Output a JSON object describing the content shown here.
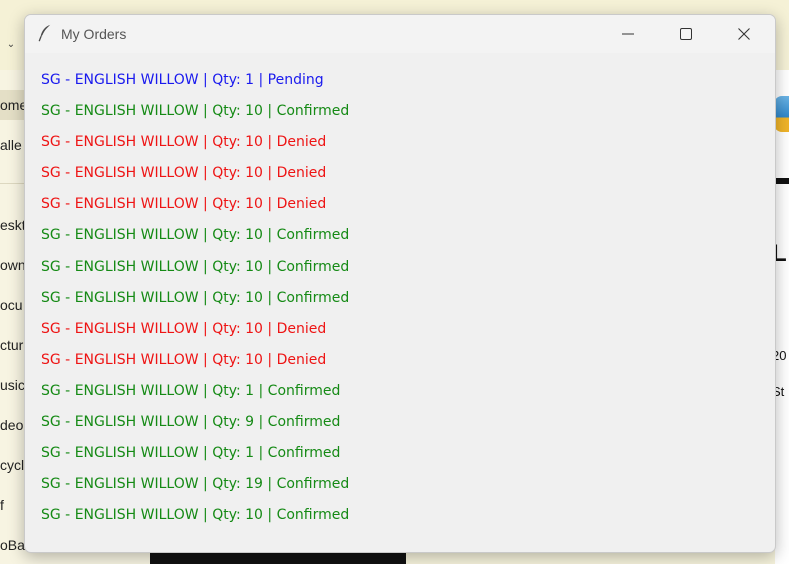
{
  "window": {
    "title": "My Orders",
    "app_icon": "feather-icon",
    "controls": [
      "minimize-icon",
      "maximize-icon",
      "close-icon"
    ]
  },
  "status_colors": {
    "Pending": "#1a1aee",
    "Confirmed": "#158a15",
    "Denied": "#ee1414"
  },
  "orders": [
    {
      "text": "SG - ENGLISH WILLOW | Qty: 1 | Pending",
      "status": "Pending"
    },
    {
      "text": "SG - ENGLISH WILLOW | Qty: 10 | Confirmed",
      "status": "Confirmed"
    },
    {
      "text": "SG - ENGLISH WILLOW | Qty: 10 | Denied",
      "status": "Denied"
    },
    {
      "text": "SG - ENGLISH WILLOW | Qty: 10 | Denied",
      "status": "Denied"
    },
    {
      "text": "SG - ENGLISH WILLOW | Qty: 10 | Denied",
      "status": "Denied"
    },
    {
      "text": "SG - ENGLISH WILLOW | Qty: 10 | Confirmed",
      "status": "Confirmed"
    },
    {
      "text": "SG - ENGLISH WILLOW | Qty: 10 | Confirmed",
      "status": "Confirmed"
    },
    {
      "text": "SG - ENGLISH WILLOW | Qty: 10 | Confirmed",
      "status": "Confirmed"
    },
    {
      "text": "SG - ENGLISH WILLOW | Qty: 10 | Denied",
      "status": "Denied"
    },
    {
      "text": "SG - ENGLISH WILLOW | Qty: 10 | Denied",
      "status": "Denied"
    },
    {
      "text": "SG - ENGLISH WILLOW | Qty: 1 | Confirmed",
      "status": "Confirmed"
    },
    {
      "text": "SG - ENGLISH WILLOW | Qty: 9 | Confirmed",
      "status": "Confirmed"
    },
    {
      "text": "SG - ENGLISH WILLOW | Qty: 1 | Confirmed",
      "status": "Confirmed"
    },
    {
      "text": "SG - ENGLISH WILLOW | Qty: 19 | Confirmed",
      "status": "Confirmed"
    },
    {
      "text": "SG - ENGLISH WILLOW | Qty: 10 | Confirmed",
      "status": "Confirmed"
    }
  ],
  "background": {
    "sidebar_items": [
      "ome",
      "alle",
      "eskto",
      "own",
      "ocu",
      "cture",
      "usic",
      "deo",
      "cycl",
      "f",
      "oBa"
    ],
    "right_fragments": [
      "L",
      "20",
      "St"
    ]
  }
}
